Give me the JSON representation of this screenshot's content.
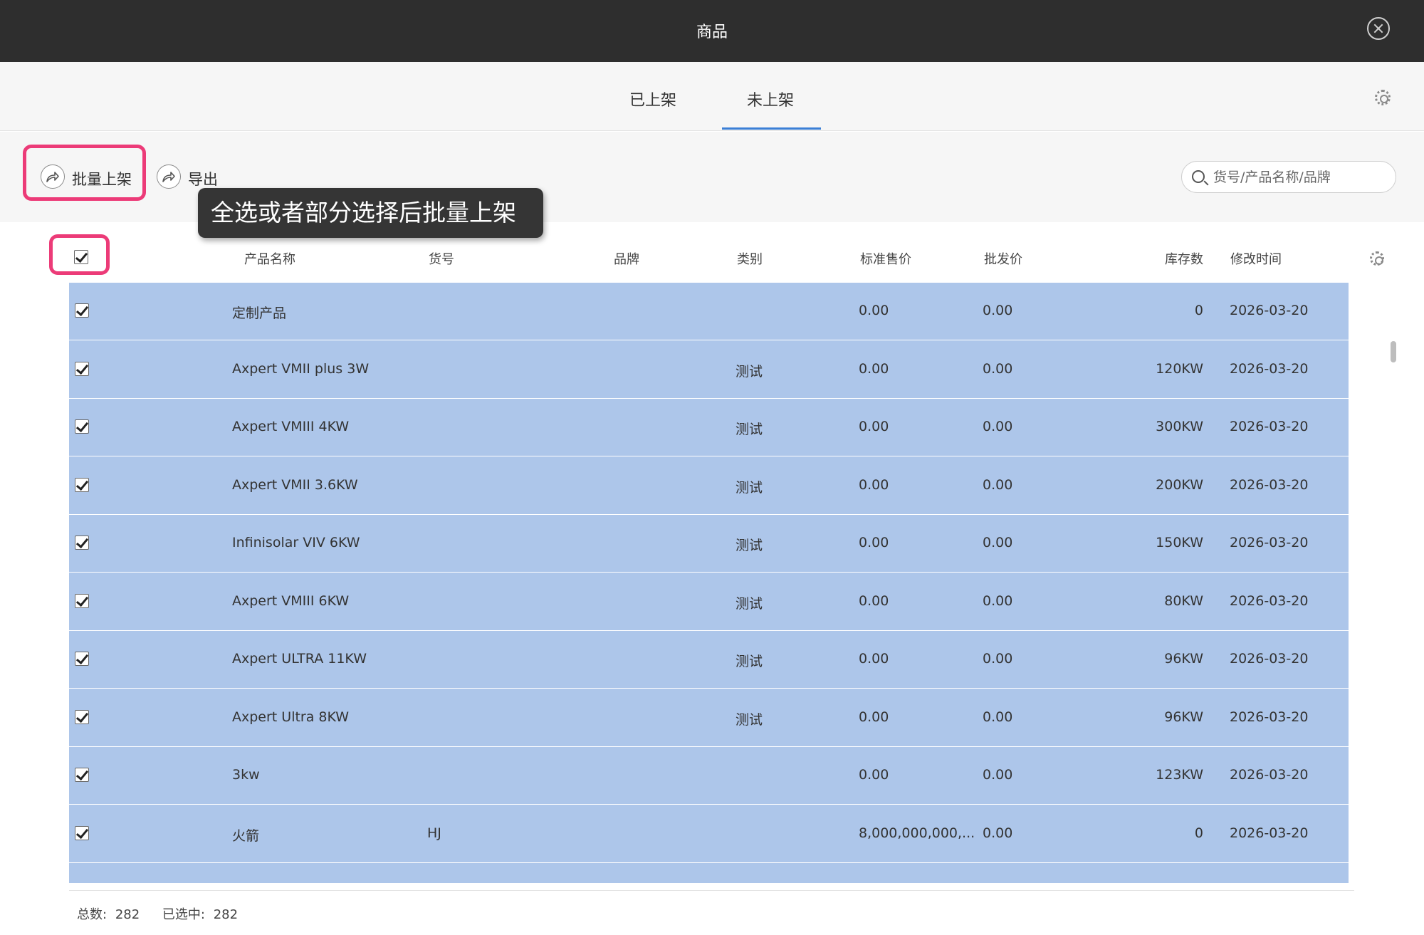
{
  "window": {
    "title": "商品"
  },
  "tabs": [
    {
      "label": "已上架"
    },
    {
      "label": "未上架"
    }
  ],
  "toolbar": {
    "batch_label": "批量上架",
    "export_label": "导出",
    "search_placeholder": "货号/产品名称/品牌"
  },
  "tooltip": "全选或者部分选择后批量上架",
  "table": {
    "columns": [
      "产品名称",
      "货号",
      "品牌",
      "类别",
      "标准售价",
      "批发价",
      "库存数",
      "修改时间"
    ],
    "rows": [
      {
        "name": "定制产品",
        "sku": "",
        "brand": "",
        "category": "",
        "price": "0.00",
        "wholesale": "0.00",
        "stock": "0",
        "modified": "2026-03-20"
      },
      {
        "name": "Axpert VMII plus 3W",
        "sku": "",
        "brand": "",
        "category": "测试",
        "price": "0.00",
        "wholesale": "0.00",
        "stock": "120KW",
        "modified": "2026-03-20"
      },
      {
        "name": "Axpert VMIII 4KW",
        "sku": "",
        "brand": "",
        "category": "测试",
        "price": "0.00",
        "wholesale": "0.00",
        "stock": "300KW",
        "modified": "2026-03-20"
      },
      {
        "name": "Axpert VMII 3.6KW",
        "sku": "",
        "brand": "",
        "category": "测试",
        "price": "0.00",
        "wholesale": "0.00",
        "stock": "200KW",
        "modified": "2026-03-20"
      },
      {
        "name": "Infinisolar VIV 6KW",
        "sku": "",
        "brand": "",
        "category": "测试",
        "price": "0.00",
        "wholesale": "0.00",
        "stock": "150KW",
        "modified": "2026-03-20"
      },
      {
        "name": "Axpert VMIII 6KW",
        "sku": "",
        "brand": "",
        "category": "测试",
        "price": "0.00",
        "wholesale": "0.00",
        "stock": "80KW",
        "modified": "2026-03-20"
      },
      {
        "name": "Axpert ULTRA 11KW",
        "sku": "",
        "brand": "",
        "category": "测试",
        "price": "0.00",
        "wholesale": "0.00",
        "stock": "96KW",
        "modified": "2026-03-20"
      },
      {
        "name": "Axpert Ultra 8KW",
        "sku": "",
        "brand": "",
        "category": "测试",
        "price": "0.00",
        "wholesale": "0.00",
        "stock": "96KW",
        "modified": "2026-03-20"
      },
      {
        "name": "3kw",
        "sku": "",
        "brand": "",
        "category": "",
        "price": "0.00",
        "wholesale": "0.00",
        "stock": "123KW",
        "modified": "2026-03-20"
      },
      {
        "name": "火箭",
        "sku": "HJ",
        "brand": "",
        "category": "",
        "price": "8,000,000,000,...",
        "wholesale": "0.00",
        "stock": "0",
        "modified": "2026-03-20"
      }
    ]
  },
  "footer": {
    "total_label": "总数:",
    "total_value": "282",
    "selected_label": "已选中:",
    "selected_value": "282"
  },
  "colors": {
    "selected_row_bg": "#adc6ea",
    "highlight_border": "#ec3b78",
    "tab_active": "#3b7fd6",
    "titlebar_bg": "#2e2e2e"
  }
}
